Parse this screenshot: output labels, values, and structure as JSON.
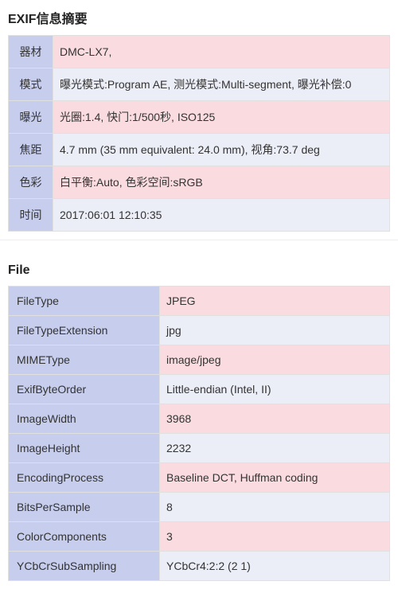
{
  "summary": {
    "title": "EXIF信息摘要",
    "rows": [
      {
        "label": "器材",
        "value": "DMC-LX7,"
      },
      {
        "label": "模式",
        "value": "曝光模式:Program AE, 测光模式:Multi-segment, 曝光补偿:0"
      },
      {
        "label": "曝光",
        "value": "光圈:1.4, 快门:1/500秒, ISO125"
      },
      {
        "label": "焦距",
        "value": "4.7 mm (35 mm equivalent: 24.0 mm), 视角:73.7 deg"
      },
      {
        "label": "色彩",
        "value": "白平衡:Auto, 色彩空间:sRGB"
      },
      {
        "label": "时间",
        "value": "2017:06:01 12:10:35"
      }
    ]
  },
  "file": {
    "title": "File",
    "rows": [
      {
        "label": "FileType",
        "value": "JPEG"
      },
      {
        "label": "FileTypeExtension",
        "value": "jpg"
      },
      {
        "label": "MIMEType",
        "value": "image/jpeg"
      },
      {
        "label": "ExifByteOrder",
        "value": "Little-endian (Intel, II)"
      },
      {
        "label": "ImageWidth",
        "value": "3968"
      },
      {
        "label": "ImageHeight",
        "value": "2232"
      },
      {
        "label": "EncodingProcess",
        "value": "Baseline DCT, Huffman coding"
      },
      {
        "label": "BitsPerSample",
        "value": "8"
      },
      {
        "label": "ColorComponents",
        "value": "3"
      },
      {
        "label": "YCbCrSubSampling",
        "value": "YCbCr4:2:2 (2 1)"
      }
    ]
  }
}
